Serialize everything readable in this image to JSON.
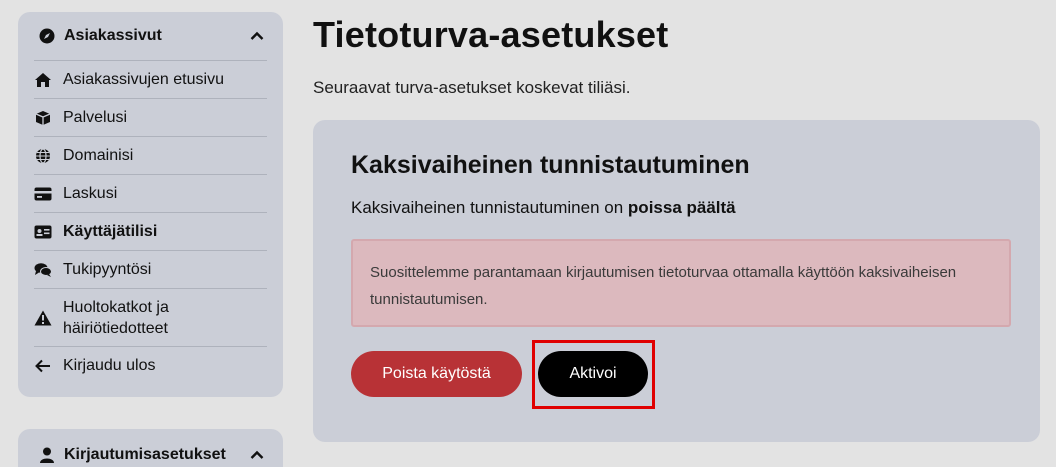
{
  "sidebar": {
    "nav_card": {
      "title": "Asiakassivut",
      "title_icon": "compass-icon",
      "collapse_icon": "chevron-up-icon",
      "items": [
        {
          "label": "Asiakassivujen etusivu",
          "icon": "home-icon",
          "active": false
        },
        {
          "label": "Palvelusi",
          "icon": "box-icon",
          "active": false
        },
        {
          "label": "Domainisi",
          "icon": "globe-icon",
          "active": false
        },
        {
          "label": "Laskusi",
          "icon": "credit-card-icon",
          "active": false
        },
        {
          "label": "Käyttäjätilisi",
          "icon": "id-card-icon",
          "active": true
        },
        {
          "label": "Tukipyyntösi",
          "icon": "comments-icon",
          "active": false
        },
        {
          "label": "Huoltokatkot ja häiriötiedotteet",
          "icon": "warning-icon",
          "active": false
        },
        {
          "label": "Kirjaudu ulos",
          "icon": "arrow-left-icon",
          "active": false
        }
      ]
    },
    "login_card": {
      "title": "Kirjautumisasetukset",
      "title_icon": "user-icon",
      "collapse_icon": "chevron-up-icon"
    }
  },
  "main": {
    "title": "Tietoturva-asetukset",
    "subtitle": "Seuraavat turva-asetukset koskevat tiliäsi.",
    "tfa": {
      "title": "Kaksivaiheinen tunnistautuminen",
      "status_prefix": "Kaksivaiheinen tunnistautuminen on",
      "status_value": "poissa päältä",
      "alert": "Suosittelemme parantamaan kirjautumisen tietoturvaa ottamalla käyttöön kaksivaiheisen tunnistautumisen.",
      "remove_button": "Poista käytöstä",
      "activate_button": "Aktivoi"
    }
  },
  "colors": {
    "page_bg": "#e3e3e3",
    "card_bg": "#cbced7",
    "danger": "#b83236",
    "primary": "#000000",
    "alert_bg": "#dcb9be",
    "highlight": "#e00000"
  }
}
